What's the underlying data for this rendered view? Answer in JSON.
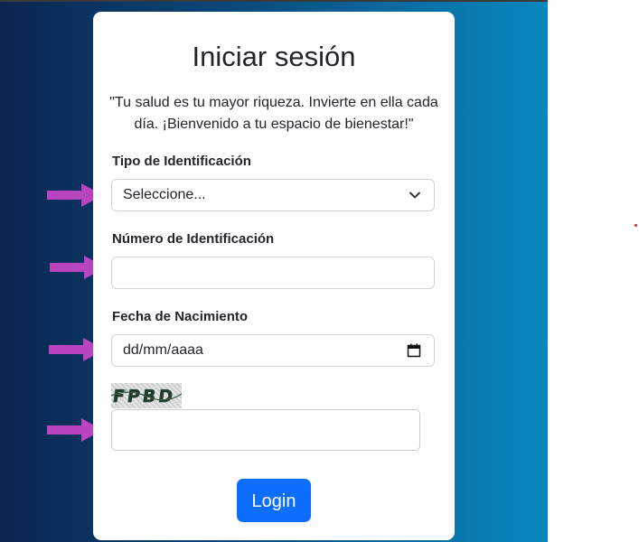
{
  "login": {
    "title": "Iniciar sesión",
    "quote": "\"Tu salud es tu mayor riqueza. Invierte en ella cada día. ¡Bienvenido a tu espacio de bienestar!\"",
    "tipo_label": "Tipo de Identificación",
    "tipo_value": "Seleccione...",
    "numero_label": "Número de Identificación",
    "numero_value": "",
    "fecha_label": "Fecha de Nacimiento",
    "fecha_placeholder": "dd/mm/aaaa",
    "captcha_text": "FPBD",
    "captcha_value": "",
    "login_button": "Login"
  },
  "icons": {
    "select": "chevron-down-icon",
    "date": "calendar-icon",
    "annotation": "arrow-right-icon"
  },
  "colors": {
    "primary": "#0d6efd",
    "arrow": "#b844c0",
    "background_start": "#0a2550",
    "background_end": "#0989bf"
  }
}
